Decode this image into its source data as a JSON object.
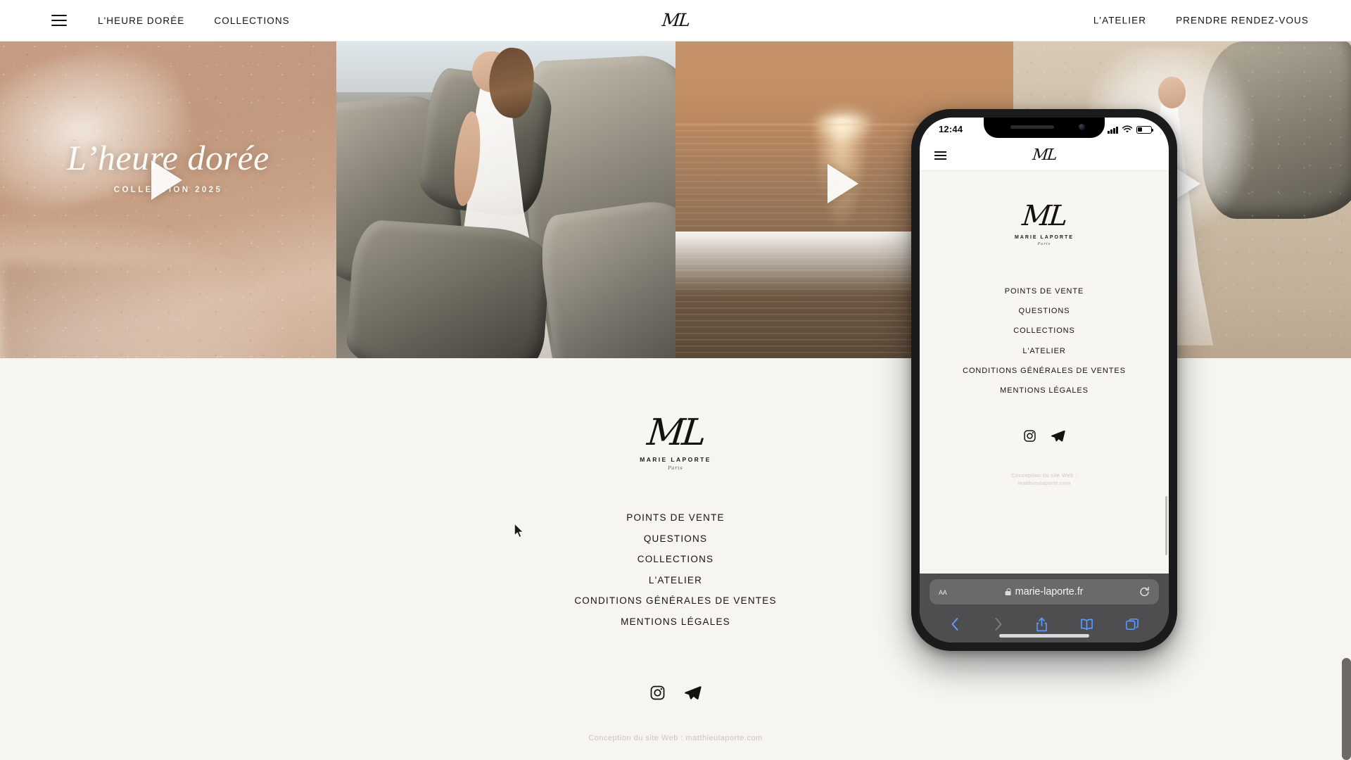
{
  "header": {
    "menu_icon": "hamburger-menu-icon",
    "logo": {
      "monogram": "ML"
    },
    "left_links": [
      "L'HEURE DORÉE",
      "COLLECTIONS"
    ],
    "right_links": [
      "L'ATELIER",
      "PRENDRE RENDEZ-VOUS"
    ]
  },
  "hero": {
    "title": "L’heure dorée",
    "subtitle": "COLLECTION 2025",
    "next_arrow_label": "next-slide",
    "slides": [
      {
        "alt": "sandy shoreline with foam, golden sand"
      },
      {
        "alt": "bride in white gown walking on dark rocks"
      },
      {
        "alt": "sunset over ocean with golden light path"
      },
      {
        "alt": "bride with veil on sandy beach near rocks"
      }
    ]
  },
  "footer": {
    "logo": {
      "monogram": "ML",
      "name": "MARIE LAPORTE",
      "city": "Paris"
    },
    "menu": [
      "POINTS DE VENTE",
      "QUESTIONS",
      "COLLECTIONS",
      "L'ATELIER",
      "CONDITIONS GÉNÉRALES DE VENTES",
      "MENTIONS LÉGALES"
    ],
    "social": [
      "instagram-icon",
      "telegram-icon"
    ],
    "credit": "Conception du site Web : matthieulaporte.com"
  },
  "phone": {
    "statusbar": {
      "time": "12:44",
      "signal": "signal-bars-icon",
      "wifi": "wifi-icon",
      "battery": "battery-icon"
    },
    "nav": {
      "menu_icon": "hamburger-menu-icon",
      "logo": "ML"
    },
    "logo": {
      "monogram": "ML",
      "name": "MARIE LAPORTE",
      "city": "Paris"
    },
    "menu": [
      "POINTS DE VENTE",
      "QUESTIONS",
      "COLLECTIONS",
      "L'ATELIER",
      "CONDITIONS GÉNÉRALES DE VENTES",
      "MENTIONS LÉGALES"
    ],
    "social": [
      "instagram-icon",
      "telegram-icon"
    ],
    "credit_line1": "Conception du site Web :",
    "credit_line2": "matthieulaporte.com",
    "safari": {
      "text_size_label": "AA",
      "lock": "lock-icon",
      "url": "marie-laporte.fr",
      "reload": "reload-icon",
      "tools": [
        "back-icon",
        "forward-icon",
        "share-icon",
        "bookmarks-icon",
        "tabs-icon"
      ]
    }
  },
  "colors": {
    "page_bg": "#f7f5f1",
    "header_bg": "#ffffff",
    "text": "#16120f",
    "credit": "#c9c5bd",
    "safari_chrome": "#4e4e50",
    "safari_accent": "#5e9cff"
  }
}
